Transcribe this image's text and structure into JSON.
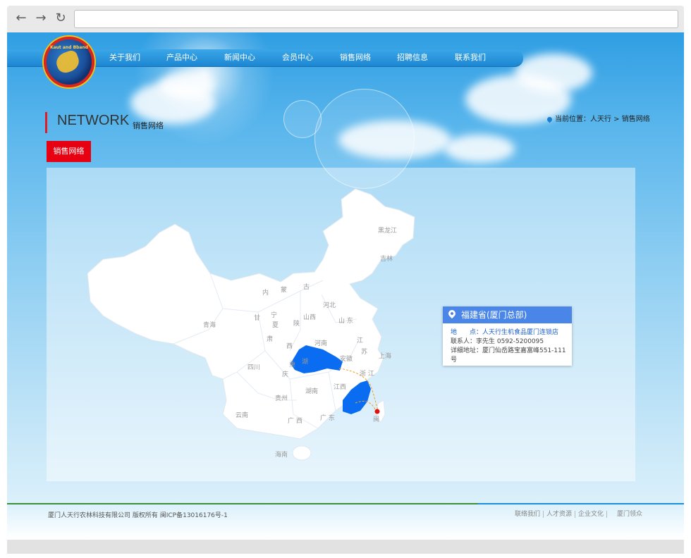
{
  "nav": {
    "items": [
      "关于我们",
      "产品中心",
      "新闻中心",
      "会员中心",
      "销售网络",
      "招聘信息",
      "联系我们"
    ]
  },
  "logo": {
    "text": "Kaut and Bband"
  },
  "page": {
    "title_en": "NETWORK",
    "title_cn": "销售网络",
    "breadcrumb": "当前位置：人天行 > 销售网络",
    "tab_label": "销售网络"
  },
  "map": {
    "provinces": [
      "黑龙江",
      "吉林",
      "内",
      "蒙",
      "古",
      "河北",
      "山西",
      "山 东",
      "河南",
      "甘",
      "宁",
      "夏",
      "陕",
      "肃",
      "西",
      "青海",
      "江",
      "苏",
      "安徽",
      "上海",
      "浙 江",
      "四川",
      "湖",
      "重",
      "庆",
      "江西",
      "湖南",
      "贵州",
      "云南",
      "广 西",
      "广 东",
      "海南",
      "闽"
    ],
    "highlight_color": "#0a6cf0"
  },
  "info_card": {
    "title": "福建省(厦门总部)",
    "address": "地　　点：人天行生机食品厦门连锁店",
    "contact": "联系人：李先生  0592-5200095",
    "detail": "详细地址：厦门仙岳路宝嘉富峰551-111号"
  },
  "footer": {
    "copyright": "厦门人天行农林科技有限公司 版权所有 闽ICP备13016176号-1",
    "links": [
      "联络我们",
      "人才资源",
      "企业文化",
      "厦门领众"
    ]
  }
}
